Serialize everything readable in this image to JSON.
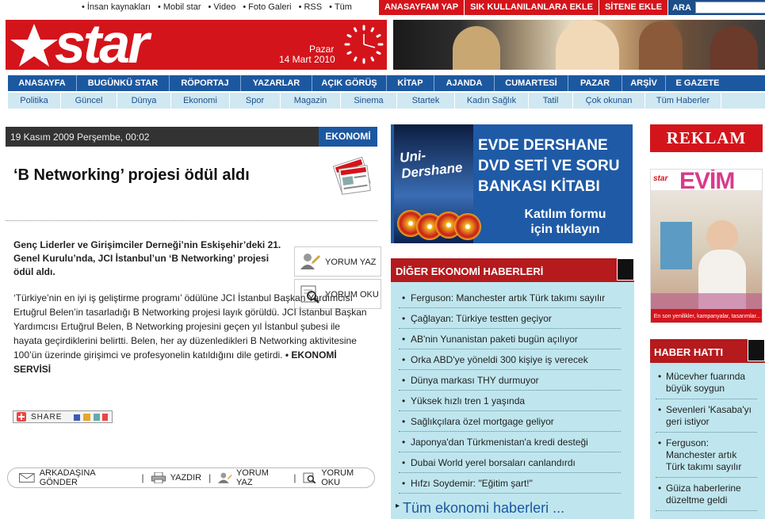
{
  "topbar": {
    "links": [
      "İnsan kaynakları",
      "Mobil star",
      "Video",
      "Foto Galeri",
      "RSS",
      "Tüm"
    ],
    "buttons": [
      "ANASAYFAM YAP",
      "SIK KULLANILANLARA EKLE",
      "SİTENE EKLE"
    ],
    "search_label": "ARA",
    "search_value": ""
  },
  "header": {
    "logo": "star",
    "day": "Pazar",
    "date": "14 Mart 2010"
  },
  "nav_main": [
    "ANASAYFA",
    "BUGÜNKÜ STAR",
    "RÖPORTAJ",
    "YAZARLAR",
    "AÇIK GÖRÜŞ",
    "KİTAP",
    "AJANDA",
    "CUMARTESİ",
    "PAZAR",
    "ARŞİV",
    "E GAZETE"
  ],
  "nav_sub": [
    "Politika",
    "Güncel",
    "Dünya",
    "Ekonomi",
    "Spor",
    "Magazin",
    "Sinema",
    "Startek",
    "Kadın Sağlık",
    "Tatil",
    "Çok okunan",
    "Tüm Haberler"
  ],
  "article": {
    "datetime": "19 Kasım 2009 Perşembe, 00:02",
    "category": "EKONOMİ",
    "title": "‘B Networking’ projesi ödül aldı",
    "lead": "Genç Liderler ve Girişimciler Derneği’nin Eskişehir’deki 21. Genel Kurulu’nda, JCI İstanbul’un ‘B Networking’ projesi ödül aldı.",
    "body": "‘Türkiye’nin en iyi iş geliştirme programı’ ödülüne JCI İstanbul Başkan Yardımcısı Ertuğrul Belen’in tasarladığı B Networking projesi layık görüldü. JCI İstanbul Başkan Yardımcısı Ertuğrul Belen, B Networking projesini geçen yıl İstanbul şubesi ile hayata geçirdiklerini belirtti. Belen, her ay düzenledikleri B Networking aktivitesine 100’ün üzerinde girişimci ve profesyonelin katıldığını dile getirdi.",
    "byline": "• EKONOMİ SERVİSİ",
    "yorum_yaz": "YORUM YAZ",
    "yorum_oku": "YORUM OKU",
    "share": "SHARE"
  },
  "article_tools": [
    "ARKADAŞINA GÖNDER",
    "YAZDIR",
    "YORUM YAZ",
    "YORUM OKU"
  ],
  "promo": {
    "line1": "EVDE DERSHANE",
    "line2": "DVD SETİ VE SORU",
    "line3": "BANKASI KİTABI",
    "cta1": "Katılım formu",
    "cta2": "için tıklayın",
    "box_label": "Uni-Dershane"
  },
  "diger": {
    "title": "DİĞER EKONOMİ HABERLERİ",
    "items": [
      "Ferguson: Manchester artık Türk takımı sayılır",
      "Çağlayan: Türkiye testten geçiyor",
      "AB'nin Yunanistan paketi bugün açılıyor",
      "Orka ABD'ye yöneldi 300 kişiye iş verecek",
      "Dünya markası THY durmuyor",
      "Yüksek hızlı tren 1 yaşında",
      "Sağlıkçılara özel mortgage geliyor",
      "Japonya'dan Türkmenistan'a kredi desteği",
      "Dubai World yerel borsaları canlandırdı",
      "Hıfzı Soydemir: \"Eğitim şart!\""
    ],
    "more": "Tüm ekonomi haberleri ..."
  },
  "reklam": "REKLAM",
  "evim": {
    "brand": "EVİM",
    "star": "star",
    "footer": "En son yenilikler, kampanyalar, tasarımlar..."
  },
  "haber_hatti": {
    "title": "HABER HATTI",
    "items": [
      "Mücevher fuarında büyük soygun",
      "Sevenleri 'Kasaba'yı geri istiyor",
      "Ferguson: Manchester artık Türk takımı sayılır",
      "Güiza haberlerine düzeltme geldi"
    ]
  }
}
